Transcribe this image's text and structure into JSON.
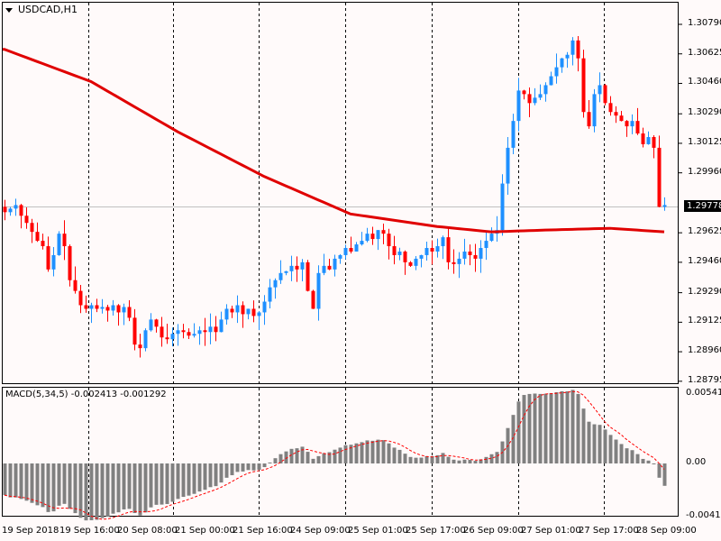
{
  "header": {
    "symbol": "USDCAD,H1"
  },
  "indicator": {
    "label": "MACD(5,34,5) -0.002413 -0.001292"
  },
  "price_axis": [
    "1.30790",
    "1.30625",
    "1.30460",
    "1.30290",
    "1.30125",
    "1.29960",
    "1.29625",
    "1.29460",
    "1.29290",
    "1.29125",
    "1.28960",
    "1.28795"
  ],
  "current_price": "1.29778",
  "macd_axis": [
    "0.005415",
    "0.00",
    "-0.004118"
  ],
  "time_axis": [
    "19 Sep 2018",
    "19 Sep 16:00",
    "20 Sep 08:00",
    "21 Sep 00:00",
    "21 Sep 16:00",
    "24 Sep 09:00",
    "25 Sep 01:00",
    "25 Sep 17:00",
    "26 Sep 09:00",
    "27 Sep 01:00",
    "27 Sep 17:00",
    "28 Sep 09:00"
  ],
  "colors": {
    "bull": "#1e90ff",
    "bear": "#ff0000",
    "ma": "#e00000",
    "hist": "#808080",
    "signal": "#ff0000",
    "bg": "#fffafa"
  },
  "chart_data": {
    "type": "candlestick",
    "price_range": [
      1.28795,
      1.3079
    ],
    "closes": [
      1.2974,
      1.2976,
      1.2978,
      1.2972,
      1.2968,
      1.2963,
      1.2958,
      1.2955,
      1.2942,
      1.295,
      1.2962,
      1.2955,
      1.2936,
      1.293,
      1.2922,
      1.292,
      1.2922,
      1.292,
      1.2921,
      1.2919,
      1.2922,
      1.2918,
      1.2921,
      1.2915,
      1.29,
      1.2898,
      1.2908,
      1.2914,
      1.291,
      1.2904,
      1.2903,
      1.2906,
      1.2908,
      1.2907,
      1.2905,
      1.2906,
      1.2908,
      1.2907,
      1.291,
      1.2907,
      1.2914,
      1.292,
      1.2918,
      1.2922,
      1.2917,
      1.292,
      1.2916,
      1.2918,
      1.2924,
      1.2932,
      1.2936,
      1.294,
      1.2941,
      1.2944,
      1.2942,
      1.2946,
      1.293,
      1.292,
      1.294,
      1.2944,
      1.2942,
      1.2948,
      1.295,
      1.2954,
      1.2952,
      1.2956,
      1.2958,
      1.2962,
      1.2959,
      1.2964,
      1.2962,
      1.2955,
      1.295,
      1.2952,
      1.2946,
      1.2944,
      1.2948,
      1.295,
      1.2954,
      1.2952,
      1.2955,
      1.296,
      1.2946,
      1.2945,
      1.2948,
      1.2952,
      1.295,
      1.2948,
      1.2954,
      1.2958,
      1.2962,
      1.2964,
      1.299,
      1.301,
      1.3025,
      1.3042,
      1.304,
      1.3035,
      1.3038,
      1.304,
      1.3045,
      1.305,
      1.3055,
      1.306,
      1.3062,
      1.307,
      1.306,
      1.303,
      1.3022,
      1.304,
      1.3045,
      1.3035,
      1.303,
      1.3028,
      1.3025,
      1.3022,
      1.3025,
      1.3018,
      1.3012,
      1.3016,
      1.301,
      1.2977,
      1.2978
    ],
    "ma_points": [
      [
        0,
        1.3065
      ],
      [
        16,
        1.3047
      ],
      [
        32,
        1.3019
      ],
      [
        48,
        1.2994
      ],
      [
        64,
        1.2973
      ],
      [
        80,
        1.2966
      ],
      [
        90,
        1.2963
      ],
      [
        100,
        1.2964
      ],
      [
        112,
        1.2965
      ],
      [
        122,
        1.2963
      ]
    ],
    "macd_params": [
      5,
      34,
      5
    ],
    "macd_range": [
      -0.004118,
      0.005415
    ]
  }
}
